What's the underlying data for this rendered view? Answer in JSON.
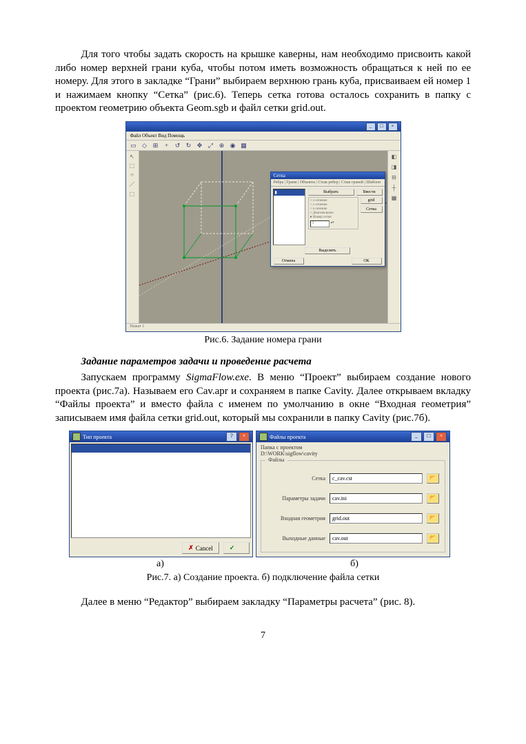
{
  "para1": "Для того чтобы задать скорость на крышке каверны, нам необходимо присвоить какой либо номер верхней грани куба, чтобы потом иметь возможность обращаться к ней по ее номеру. Для этого в закладке “Грани” выбираем верхнюю грань куба, присваиваем ей номер 1 и нажимаем кнопку “Сетка” (рис.6). Теперь сетка готова осталось сохранить в папку с проектом геометрию объекта Geom.sgb и файл сетки grid.out.",
  "fig6": {
    "menubar": "Файл  Объект  Вид  Помощь",
    "status": "Нажат 1",
    "dialog": {
      "title": "Сетка",
      "tabs": "Ребра | Грани | Объекты | Стык ребер | Стык граней | Шаблон",
      "list_selected": "▮",
      "btn_select": "Выбрать",
      "group_lines": [
        "○ x-сечение",
        "○ y-сечение",
        "○ z-сечение",
        "○ Диагональное",
        "● Номер сетки"
      ],
      "num_value": "1",
      "btn_bottom": "Выделить",
      "btn_close": "Отмена",
      "btn_ok": "ОК",
      "btn_right1": "Ввести",
      "btn_right2": "grid",
      "btn_right3": "Сетка"
    },
    "caption": "Рис.6. Задание номера грани"
  },
  "heading2": "Задание параметров задачи и проведение расчета",
  "para2_a": "Запускаем программу ",
  "para2_b": "SigmaFlow.exe",
  "para2_c": ". В меню “Проект” выбираем создание нового проекта (рис.7а). Называем его Cav.apr и сохраняем в папке Cavity. Далее открываем вкладку “Файлы проекта” и вместо файла с именем по умолчанию в окне “Входная геометрия” записываем имя файла сетки grid.out, который мы сохранили в папку Cavity (рис.7б).",
  "fig7a": {
    "title": "Тип проекта",
    "cancel": "Cancel",
    "ok": ""
  },
  "fig7b": {
    "title": "Файлы проекта",
    "path_lbl": "Папка с проектом",
    "path_val": "D:\\WORK\\sigflow\\cavity",
    "group": "Файлы",
    "rows": [
      {
        "label": "Сетка",
        "value": "c_cav.cst"
      },
      {
        "label": "Параметры задачи",
        "value": "cav.ini"
      },
      {
        "label": "Входная геометрия",
        "value": "grid.out"
      },
      {
        "label": "Выходные данные",
        "value": "cav.out"
      }
    ]
  },
  "fig7_sub_a": "а)",
  "fig7_sub_b": "б)",
  "fig7_caption": "Рис.7. а) Создание проекта. б) подключение файла сетки",
  "para3": "Далее в меню “Редактор” выбираем закладку “Параметры расчета” (рис. 8).",
  "page_number": "7"
}
